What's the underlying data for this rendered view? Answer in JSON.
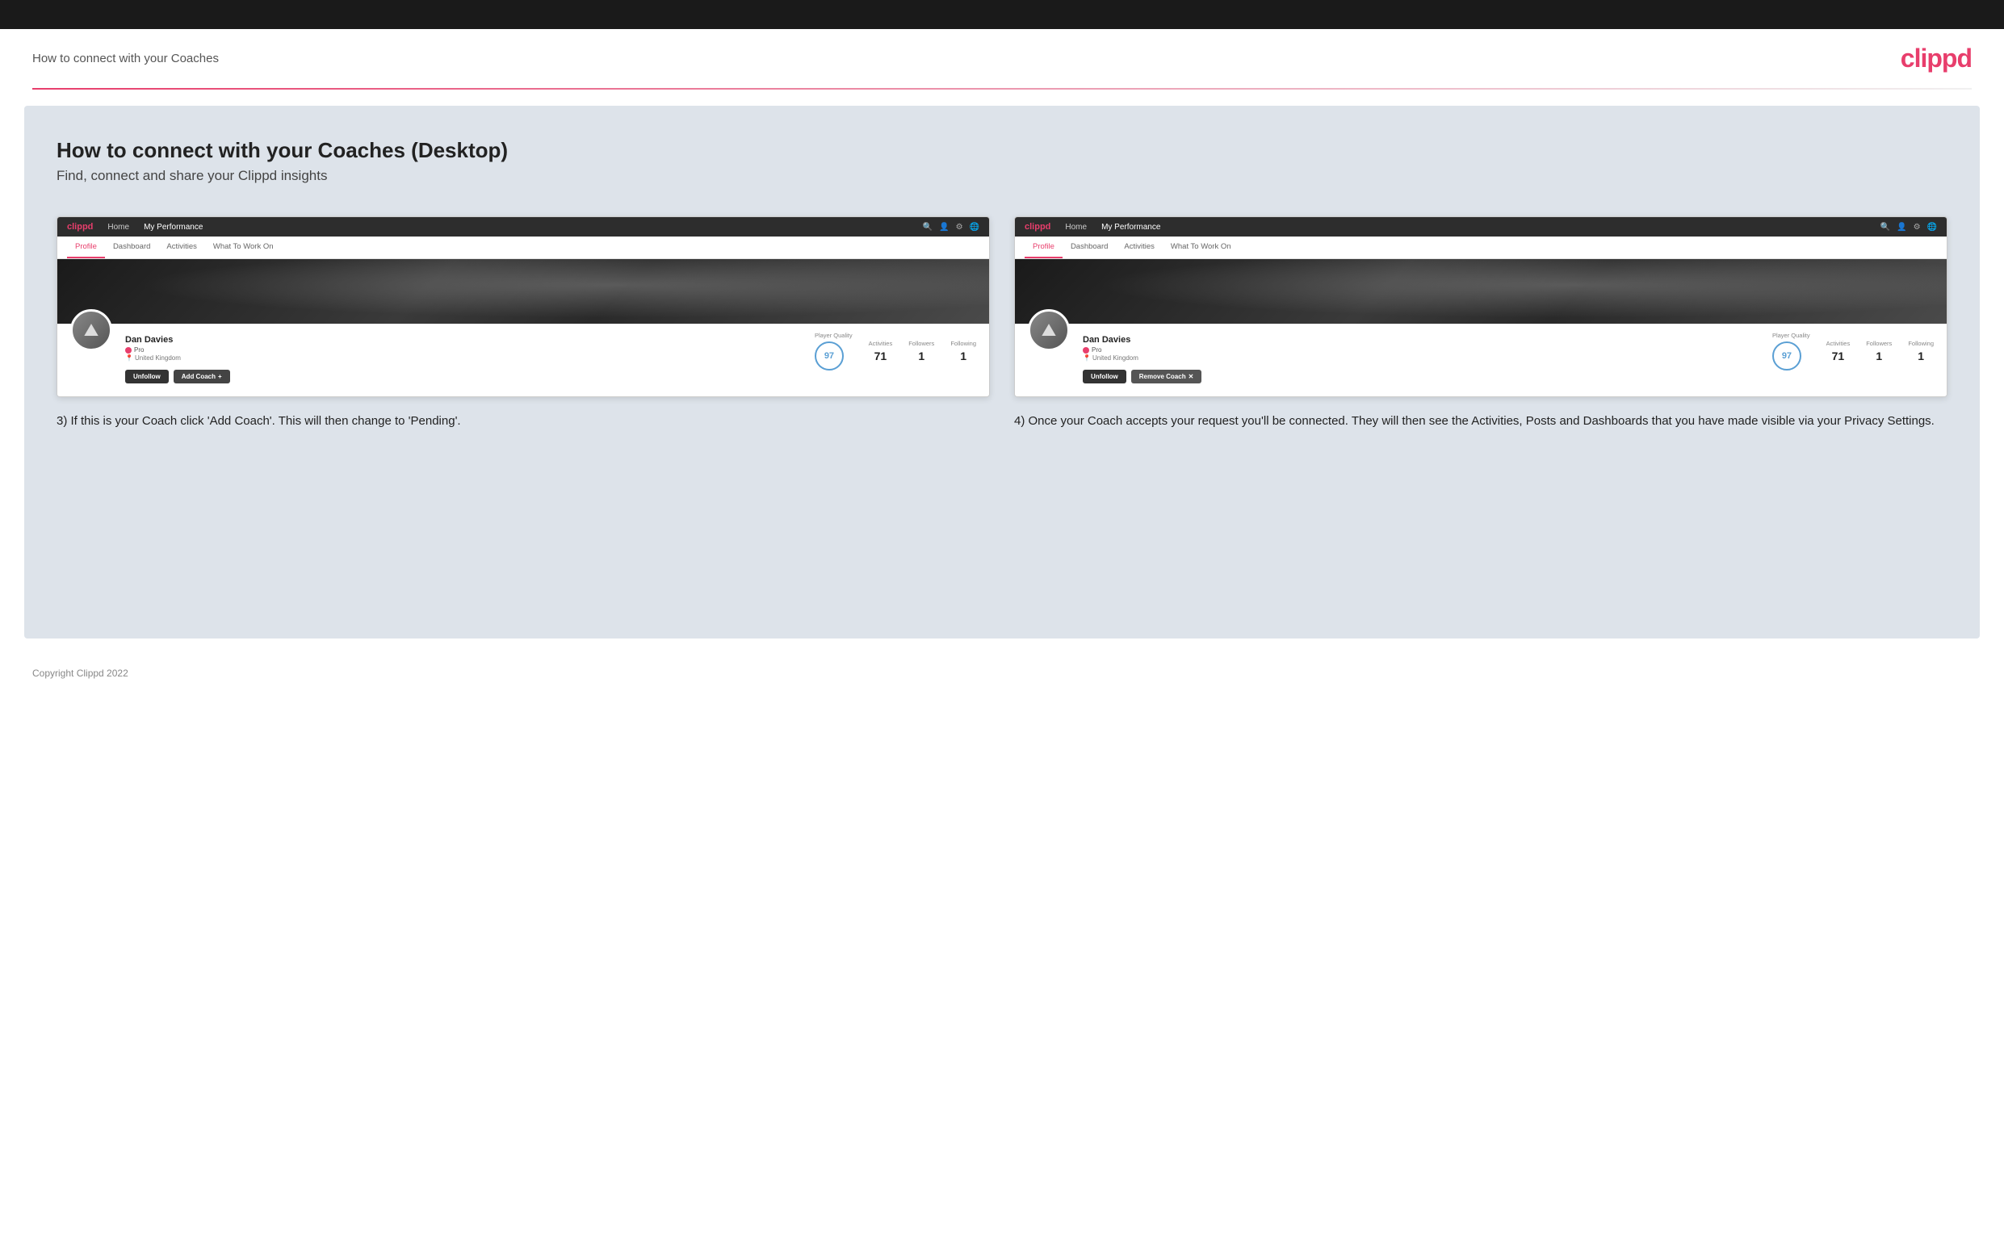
{
  "topbar": {},
  "header": {
    "title": "How to connect with your Coaches",
    "logo": "clippd"
  },
  "main": {
    "section_title": "How to connect with your Coaches (Desktop)",
    "section_subtitle": "Find, connect and share your Clippd insights",
    "left_panel": {
      "nav": {
        "logo": "clippd",
        "links": [
          "Home",
          "My Performance"
        ],
        "icons": [
          "search",
          "user",
          "bell",
          "globe"
        ]
      },
      "tabs": [
        "Profile",
        "Dashboard",
        "Activities",
        "What To Work On"
      ],
      "active_tab": "Profile",
      "user": {
        "name": "Dan Davies",
        "badge": "Pro",
        "location": "United Kingdom",
        "player_quality_label": "Player Quality",
        "player_quality_value": "97",
        "activities_label": "Activities",
        "activities_value": "71",
        "followers_label": "Followers",
        "followers_value": "1",
        "following_label": "Following",
        "following_value": "1"
      },
      "buttons": [
        "Unfollow",
        "Add Coach"
      ],
      "caption": "3) If this is your Coach click 'Add Coach'. This will then change to 'Pending'."
    },
    "right_panel": {
      "nav": {
        "logo": "clippd",
        "links": [
          "Home",
          "My Performance"
        ],
        "icons": [
          "search",
          "user",
          "bell",
          "globe"
        ]
      },
      "tabs": [
        "Profile",
        "Dashboard",
        "Activities",
        "What To Work On"
      ],
      "active_tab": "Profile",
      "user": {
        "name": "Dan Davies",
        "badge": "Pro",
        "location": "United Kingdom",
        "player_quality_label": "Player Quality",
        "player_quality_value": "97",
        "activities_label": "Activities",
        "activities_value": "71",
        "followers_label": "Followers",
        "followers_value": "1",
        "following_label": "Following",
        "following_value": "1"
      },
      "buttons": [
        "Unfollow",
        "Remove Coach"
      ],
      "caption": "4) Once your Coach accepts your request you'll be connected. They will then see the Activities, Posts and Dashboards that you have made visible via your Privacy Settings."
    }
  },
  "footer": {
    "copyright": "Copyright Clippd 2022"
  }
}
